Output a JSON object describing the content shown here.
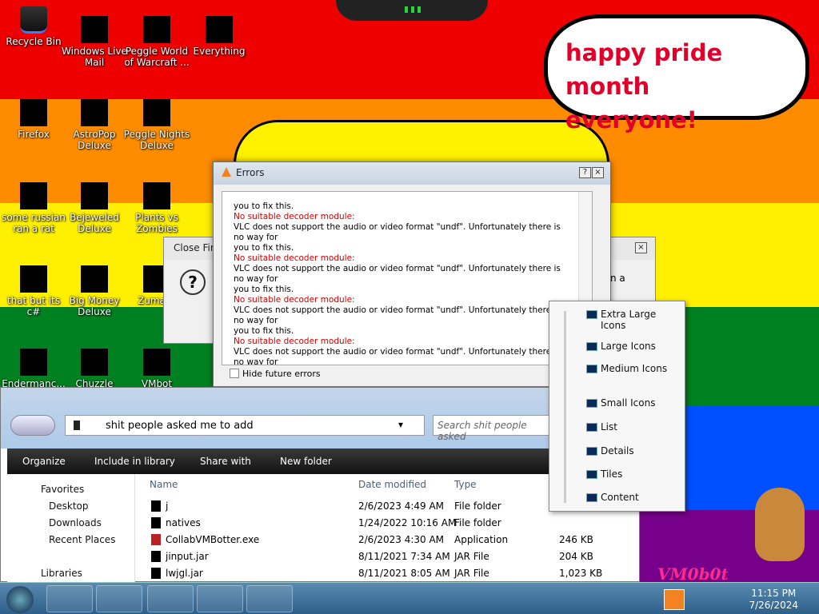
{
  "desktop": {
    "speech_bubble": [
      "happy pride month",
      "everyone!"
    ],
    "icons": [
      {
        "label": "Recycle Bin",
        "icon": "recycle-bin-icon"
      },
      {
        "label": "Windows Live Mail",
        "icon": "mail-icon"
      },
      {
        "label": "Peggle World of Warcraft ...",
        "icon": "game-icon"
      },
      {
        "label": "Everything",
        "icon": "search-icon"
      },
      {
        "label": "Firefox",
        "icon": "firefox-icon"
      },
      {
        "label": "AstroPop Deluxe",
        "icon": "game-icon"
      },
      {
        "label": "Peggle Nights Deluxe",
        "icon": "game-icon"
      },
      {
        "label": "some russian ran a rat",
        "icon": "app-icon"
      },
      {
        "label": "Bejeweled Deluxe",
        "icon": "game-icon"
      },
      {
        "label": "Plants vs Zombies",
        "icon": "game-icon"
      },
      {
        "label": "that but its c#",
        "icon": "app-icon"
      },
      {
        "label": "Big Money Deluxe",
        "icon": "game-icon"
      },
      {
        "label": "Zuma D",
        "icon": "game-icon"
      },
      {
        "label": "Endermanc...",
        "icon": "app-icon"
      },
      {
        "label": "Chuzzle",
        "icon": "game-icon"
      },
      {
        "label": "VMbot",
        "icon": "app-icon"
      }
    ],
    "logo_text": "VM0b0t"
  },
  "vlc_errors": {
    "title": "Errors",
    "help_btn": "?",
    "close_btn": "×",
    "first_line": "you to fix this.",
    "repeated_header": "No suitable decoder module:",
    "repeated_body_1": "VLC does not support the audio or video format \"undf\". Unfortunately there is no way for",
    "repeated_body_2": "you to fix this.",
    "hide_label": "Hide future errors"
  },
  "close_firefox": {
    "title": "Close Fire",
    "question_icon": "?",
    "partial_text": "n a",
    "close_btn": "×"
  },
  "explorer": {
    "breadcrumb": "shit people asked me to add",
    "search_placeholder": "Search shit people asked",
    "toolbar": {
      "organize": "Organize",
      "include": "Include in library",
      "share": "Share with",
      "new_folder": "New folder"
    },
    "nav": {
      "favorites": "Favorites",
      "desktop": "Desktop",
      "downloads": "Downloads",
      "recent": "Recent Places",
      "libraries": "Libraries"
    },
    "columns": {
      "name": "Name",
      "date": "Date modified",
      "type": "Type",
      "size": ""
    },
    "rows": [
      {
        "name": "j",
        "date": "2/6/2023 4:49 AM",
        "type": "File folder",
        "size": ""
      },
      {
        "name": "natives",
        "date": "1/24/2022 10:16 AM",
        "type": "File folder",
        "size": ""
      },
      {
        "name": "CollabVMBotter.exe",
        "date": "2/6/2023 4:30 AM",
        "type": "Application",
        "size": "246 KB"
      },
      {
        "name": "jinput.jar",
        "date": "8/11/2021 7:34 AM",
        "type": "JAR File",
        "size": "204 KB"
      },
      {
        "name": "lwjgl.jar",
        "date": "8/11/2021 8:05 AM",
        "type": "JAR File",
        "size": "1,023 KB"
      }
    ]
  },
  "view_menu": {
    "items": [
      "Extra Large Icons",
      "Large Icons",
      "Medium Icons",
      "Small Icons",
      "List",
      "Details",
      "Tiles",
      "Content"
    ]
  },
  "taskbar": {
    "time": "11:15 PM",
    "date": "7/26/2024"
  }
}
